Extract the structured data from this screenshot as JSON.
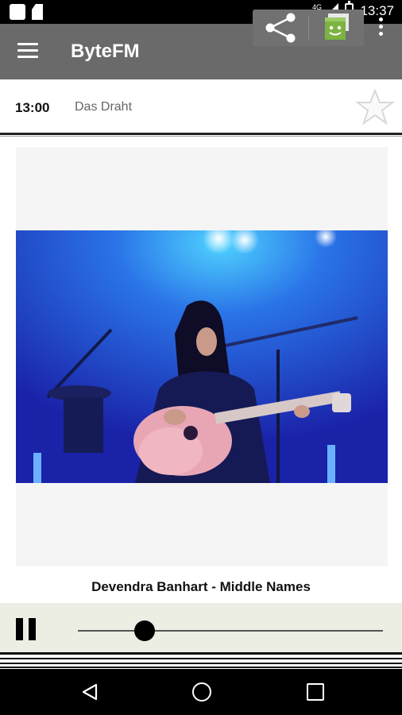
{
  "status_bar": {
    "time": "13:37",
    "network": "4G"
  },
  "app_bar": {
    "title": "ByteFM"
  },
  "program": {
    "time": "13:00",
    "name": "Das Draht",
    "favorite": false
  },
  "now_playing": {
    "track": "Devendra Banhart - Middle Names"
  },
  "player": {
    "state": "playing",
    "progress": 0.22
  },
  "colors": {
    "app_bar": "#6a6a6a",
    "player_bg": "#eceee4",
    "accent_green": "#8bc34a"
  },
  "icons": [
    "menu-icon",
    "share-icon",
    "cast-icon",
    "overflow-icon",
    "star-icon",
    "pause-icon",
    "back-icon",
    "home-icon",
    "recents-icon"
  ]
}
